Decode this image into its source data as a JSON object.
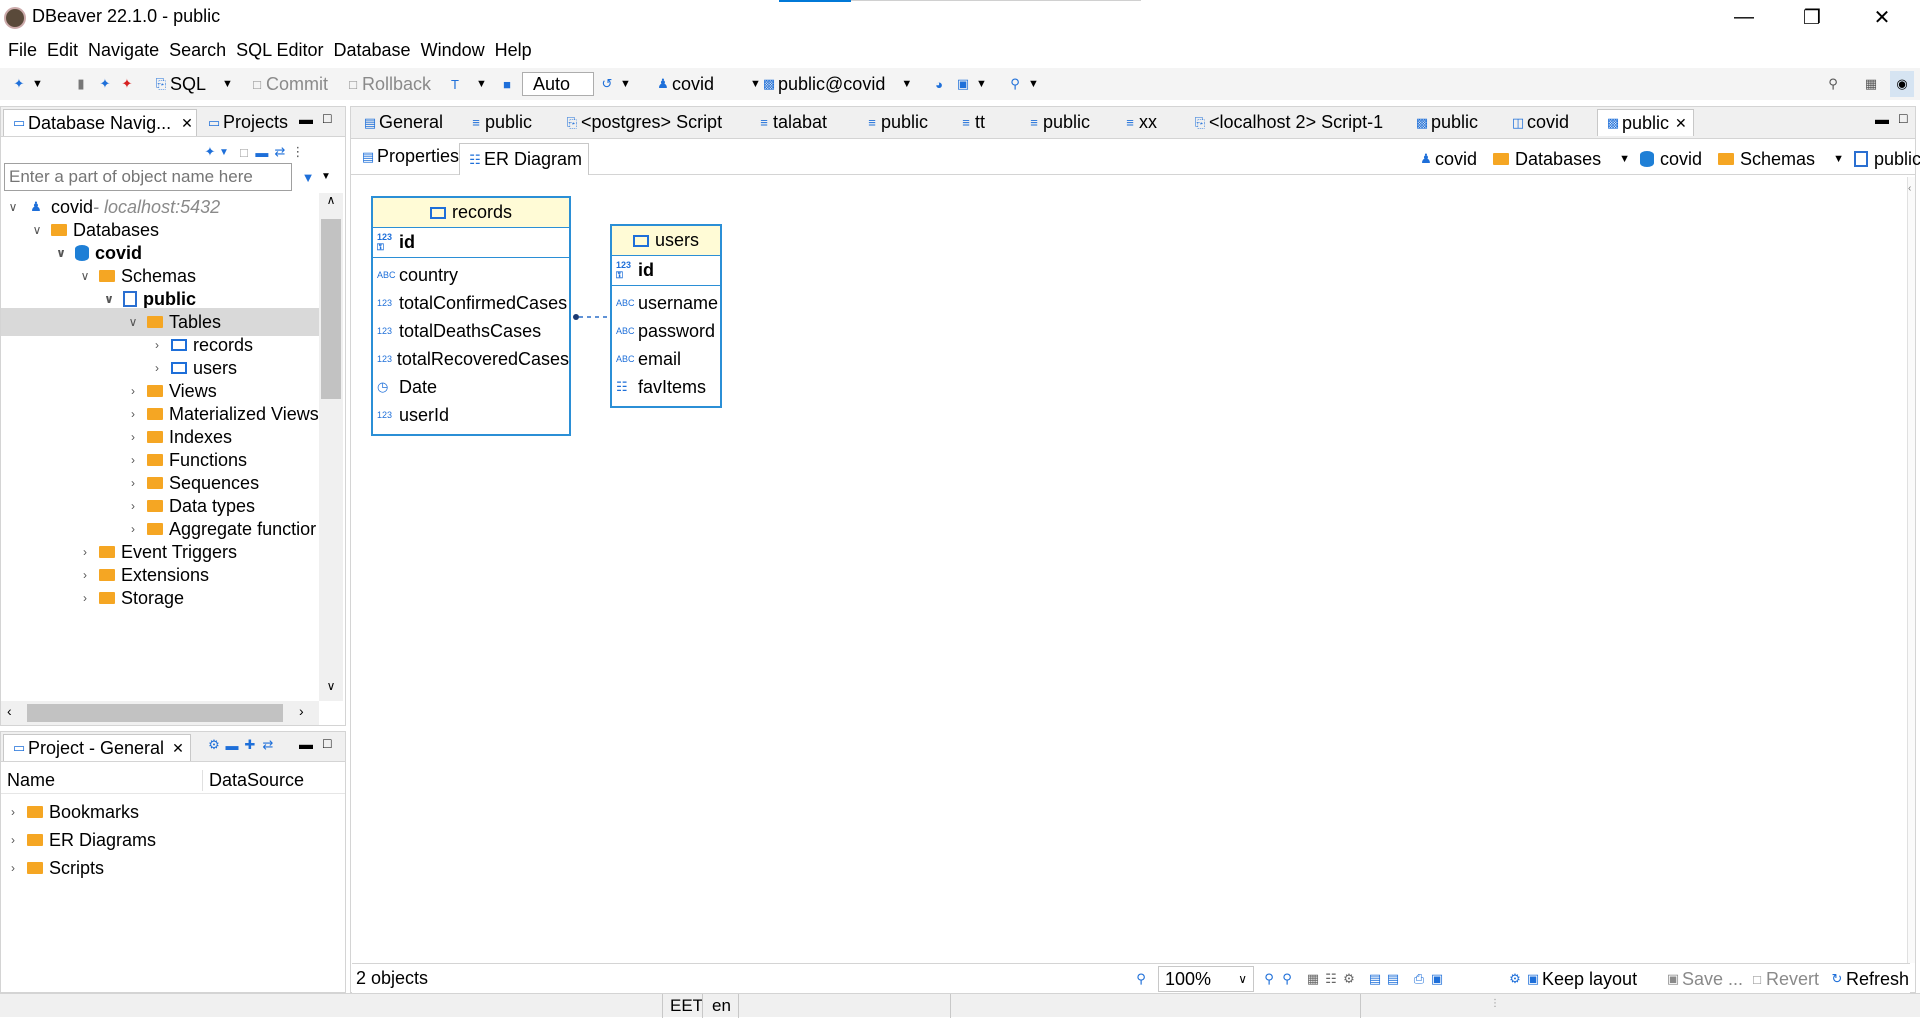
{
  "window": {
    "title": "DBeaver 22.1.0 - public"
  },
  "menu": [
    "File",
    "Edit",
    "Navigate",
    "Search",
    "SQL Editor",
    "Database",
    "Window",
    "Help"
  ],
  "toolbar": {
    "sql": "SQL",
    "commit": "Commit",
    "rollback": "Rollback",
    "auto": "Auto",
    "connection": "covid",
    "schema": "public@covid"
  },
  "left_tabs": {
    "navigator": "Database Navig...",
    "projects": "Projects"
  },
  "filter_placeholder": "Enter a part of object name here",
  "tree": {
    "covid": "covid",
    "host": " - localhost:5432",
    "databases": "Databases",
    "covid_db": "covid",
    "schemas": "Schemas",
    "public": "public",
    "tables": "Tables",
    "records": "records",
    "users": "users",
    "views": "Views",
    "mat_views": "Materialized Views",
    "indexes": "Indexes",
    "functions": "Functions",
    "sequences": "Sequences",
    "data_types": "Data types",
    "aggregate": "Aggregate functior",
    "event_triggers": "Event Triggers",
    "extensions": "Extensions",
    "storage": "Storage"
  },
  "project_panel": {
    "tab": "Project - General",
    "col_name": "Name",
    "col_datasource": "DataSource",
    "items": [
      "Bookmarks",
      "ER Diagrams",
      "Scripts"
    ]
  },
  "editor_tabs": [
    "General",
    "public",
    "<postgres> Script",
    "talabat",
    "public",
    "tt",
    "public",
    "xx",
    "<localhost 2> Script-1",
    "public",
    "covid",
    "public"
  ],
  "sub_tabs": {
    "properties": "Properties",
    "er_diagram": "ER Diagram"
  },
  "breadcrumb": {
    "conn": "covid",
    "databases": "Databases",
    "db": "covid",
    "schemas": "Schemas",
    "schema": "public"
  },
  "entities": {
    "records": {
      "name": "records",
      "pk": "id",
      "columns": [
        {
          "type": "ABC",
          "name": "country"
        },
        {
          "type": "123",
          "name": "totalConfirmedCases"
        },
        {
          "type": "123",
          "name": "totalDeathsCases"
        },
        {
          "type": "123",
          "name": "totalRecoveredCases"
        },
        {
          "type": "clock",
          "name": "Date"
        },
        {
          "type": "123",
          "name": "userId"
        }
      ]
    },
    "users": {
      "name": "users",
      "pk": "id",
      "columns": [
        {
          "type": "ABC",
          "name": "username"
        },
        {
          "type": "ABC",
          "name": "password"
        },
        {
          "type": "ABC",
          "name": "email"
        },
        {
          "type": "grid",
          "name": "favItems"
        }
      ]
    }
  },
  "status": {
    "objects": "2 objects",
    "zoom": "100%",
    "keep_layout": "Keep layout",
    "save": "Save ...",
    "revert": "Revert",
    "refresh": "Refresh"
  },
  "bottom": {
    "tz": "EET",
    "lang": "en"
  }
}
